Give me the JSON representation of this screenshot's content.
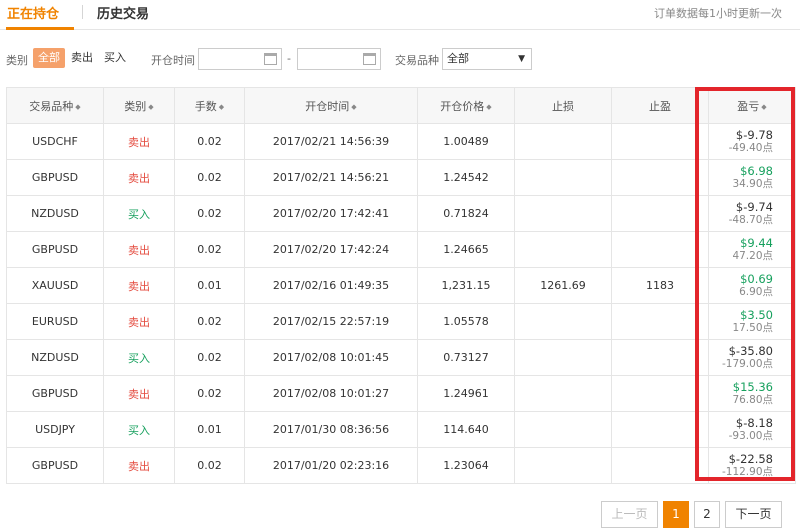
{
  "tabs": {
    "current": "正在持仓",
    "history": "历史交易"
  },
  "notice": "订单数据每1小时更新一次",
  "filters": {
    "type_label": "类别",
    "type_options": [
      "全部",
      "卖出",
      "买入"
    ],
    "open_time_label": "开仓时间",
    "symbol_label": "交易品种",
    "symbol_selected": "全部"
  },
  "table": {
    "headers": [
      "交易品种",
      "类别",
      "手数",
      "开仓时间",
      "开仓价格",
      "止损",
      "止盈",
      "盈亏"
    ],
    "rows": [
      {
        "symbol": "USDCHF",
        "type": "卖出",
        "lots": "0.02",
        "time": "2017/02/21 14:56:39",
        "price": "1.00489",
        "sl": "",
        "tp": "",
        "pnl": "$-9.78",
        "points": "-49.40点"
      },
      {
        "symbol": "GBPUSD",
        "type": "卖出",
        "lots": "0.02",
        "time": "2017/02/21 14:56:21",
        "price": "1.24542",
        "sl": "",
        "tp": "",
        "pnl": "$6.98",
        "points": "34.90点"
      },
      {
        "symbol": "NZDUSD",
        "type": "买入",
        "lots": "0.02",
        "time": "2017/02/20 17:42:41",
        "price": "0.71824",
        "sl": "",
        "tp": "",
        "pnl": "$-9.74",
        "points": "-48.70点"
      },
      {
        "symbol": "GBPUSD",
        "type": "卖出",
        "lots": "0.02",
        "time": "2017/02/20 17:42:24",
        "price": "1.24665",
        "sl": "",
        "tp": "",
        "pnl": "$9.44",
        "points": "47.20点"
      },
      {
        "symbol": "XAUUSD",
        "type": "卖出",
        "lots": "0.01",
        "time": "2017/02/16 01:49:35",
        "price": "1,231.15",
        "sl": "1261.69",
        "tp": "1183",
        "pnl": "$0.69",
        "points": "6.90点"
      },
      {
        "symbol": "EURUSD",
        "type": "卖出",
        "lots": "0.02",
        "time": "2017/02/15 22:57:19",
        "price": "1.05578",
        "sl": "",
        "tp": "",
        "pnl": "$3.50",
        "points": "17.50点"
      },
      {
        "symbol": "NZDUSD",
        "type": "买入",
        "lots": "0.02",
        "time": "2017/02/08 10:01:45",
        "price": "0.73127",
        "sl": "",
        "tp": "",
        "pnl": "$-35.80",
        "points": "-179.00点"
      },
      {
        "symbol": "GBPUSD",
        "type": "卖出",
        "lots": "0.02",
        "time": "2017/02/08 10:01:27",
        "price": "1.24961",
        "sl": "",
        "tp": "",
        "pnl": "$15.36",
        "points": "76.80点"
      },
      {
        "symbol": "USDJPY",
        "type": "买入",
        "lots": "0.01",
        "time": "2017/01/30 08:36:56",
        "price": "114.640",
        "sl": "",
        "tp": "",
        "pnl": "$-8.18",
        "points": "-93.00点"
      },
      {
        "symbol": "GBPUSD",
        "type": "卖出",
        "lots": "0.02",
        "time": "2017/01/20 02:23:16",
        "price": "1.23064",
        "sl": "",
        "tp": "",
        "pnl": "$-22.58",
        "points": "-112.90点"
      }
    ]
  },
  "pagination": {
    "prev": "上一页",
    "pages": [
      "1",
      "2"
    ],
    "current_page": "1",
    "next": "下一页"
  },
  "colors": {
    "accent": "#f08300",
    "sell": "#e44b3f",
    "buy": "#16a05d",
    "highlight": "#e3252b"
  },
  "icons": {
    "date_picker": "calendar-icon",
    "sort": "sort-icon",
    "dropdown": "caret-down-icon"
  }
}
